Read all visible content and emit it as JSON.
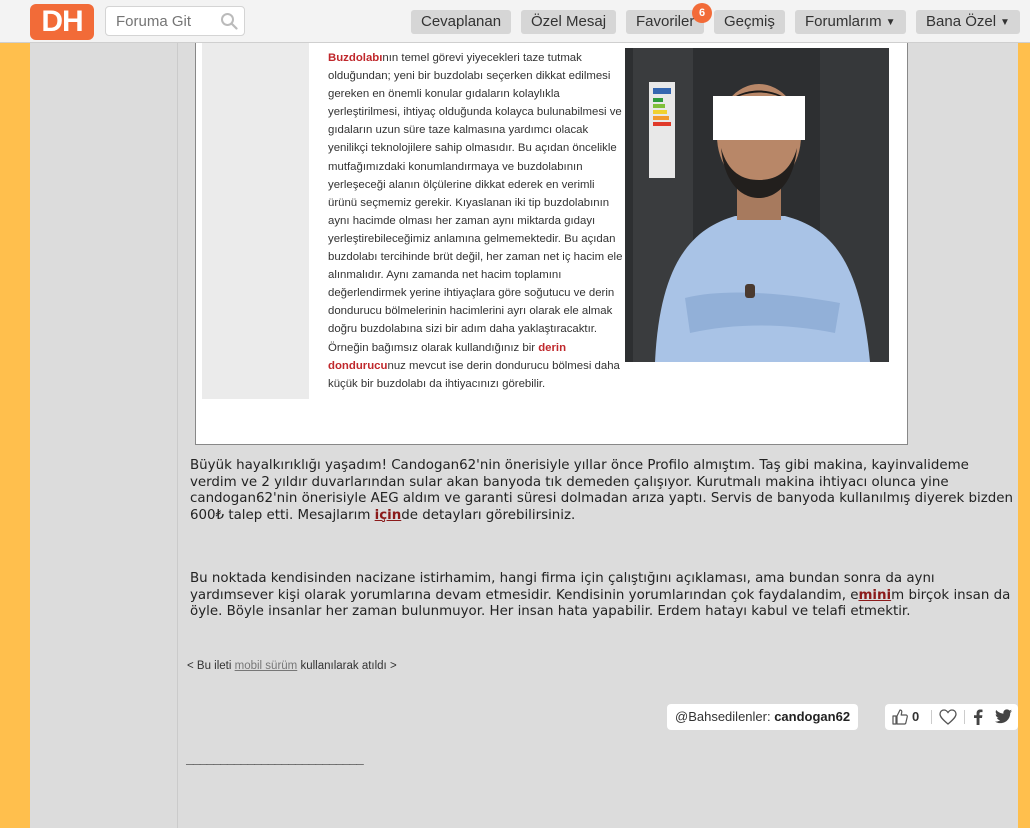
{
  "header": {
    "logo_text": "DH",
    "search_placeholder": "Foruma Git",
    "nav": {
      "replied": "Cevaplanan",
      "private_message": "Özel Mesaj",
      "favorites": "Favoriler",
      "favorites_badge": "6",
      "history": "Geçmiş",
      "forums": "Forumlarım",
      "for_me": "Bana Özel"
    }
  },
  "article": {
    "p_start_red": "Buzdolabı",
    "p_1": "nın temel görevi yiyecekleri taze tutmak olduğundan; yeni bir buzdolabı seçerken dikkat edilmesi gereken en önemli konular gıdaların kolaylıkla yerleştirilmesi, ihtiyaç olduğunda kolayca bulunabilmesi ve gıdaların uzun süre taze kalmasına yardımcı olacak yenilikçi teknolojilere sahip olmasıdır. Bu açıdan öncelikle mutfağımızdaki konumlandırmaya ve buzdolabının yerleşeceği alanın ölçülerine dikkat ederek en verimli ürünü seçmemiz gerekir. Kıyaslanan iki tip buzdolabının aynı hacimde olması her zaman aynı miktarda gıdayı yerleştirebileceğimiz anlamına gelmemektedir. Bu açıdan buzdolabı tercihinde brüt değil, her zaman net iç hacim ele alınmalıdır. Aynı zamanda net hacim toplamını değerlendirmek yerine ihtiyaçlara göre soğutucu ve derin dondurucu bölmelerinin hacimlerini ayrı olarak ele almak doğru buzdolabına sizi bir adım daha yaklaştıracaktır. Örneğin bağımsız olarak kullandığınız bir ",
    "p_red_2": "derin dondurucu",
    "p_2": "nuz mevcut ise derin dondurucu bölmesi daha küçük bir buzdolabı da ihtiyacınızı görebilir."
  },
  "post": {
    "p1_a": "Büyük hayalkırıklığı yaşadım! Candogan62'nin önerisiyle yıllar önce Profilo almıştım. Taş gibi makina, kayinvalideme verdim ve 2 yıldır duvarlarından sular akan banyoda tık demeden çalışıyor. Kurutmalı makina ihtiyacı olunca yine candogan62'nin önerisiyle AEG aldım ve garanti süresi dolmadan arıza yaptı. Servis de banyoda kullanılmış diyerek bizden 600₺ talep etti. Mesajlarım ",
    "p1_link": "için",
    "p1_b": "de detayları görebilirsiniz.",
    "p2_a": "Bu noktada kendisinden nacizane istirhamim, hangi firma için çalıştığını açıklaması, ama bundan sonra da aynı yardımsever kişi olarak yorumlarına devam etmesidir. Kendisinin yorumlarından çok faydalandim, e",
    "p2_link": "mini",
    "p2_b": "m birçok insan da öyle. Böyle insanlar her zaman bulunmuyor. Her insan hata yapabilir. Erdem hatayı kabul ve telafi etmektir.",
    "mobile_prefix": "< Bu ileti ",
    "mobile_link": "mobil sürüm",
    "mobile_suffix": " kullanılarak atıldı >"
  },
  "mentions": {
    "label": "@Bahsedilenler: ",
    "user": "candogan62"
  },
  "actions": {
    "like_count": "0"
  },
  "signature": "__________________________",
  "colors": {
    "brand": "#f26b38",
    "accent_side": "#ffbf4d",
    "link": "#8b1a1a",
    "article_red": "#c0282c"
  }
}
